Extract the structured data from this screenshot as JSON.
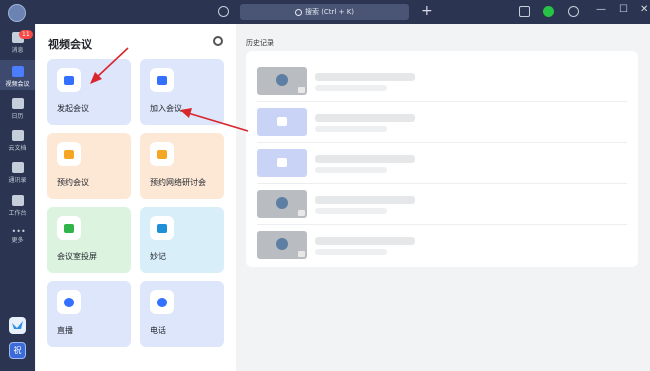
{
  "rail": {
    "badge": "11",
    "items": [
      {
        "label": "消息"
      },
      {
        "label": "视频会议"
      },
      {
        "label": "日历"
      },
      {
        "label": "云文档"
      },
      {
        "label": "通讯录"
      },
      {
        "label": "工作台"
      },
      {
        "label": "更多"
      }
    ],
    "bottom_user": "祝"
  },
  "topbar": {
    "search_placeholder": "搜索 (Ctrl + K)"
  },
  "panel": {
    "title": "视频会议",
    "cards": [
      {
        "label": "发起会议",
        "icon": "video-camera-icon"
      },
      {
        "label": "加入会议",
        "icon": "plus-icon"
      },
      {
        "label": "预约会议",
        "icon": "calendar-icon"
      },
      {
        "label": "预约网络研讨会",
        "icon": "podium-icon"
      },
      {
        "label": "会议室投屏",
        "icon": "screen-share-icon"
      },
      {
        "label": "妙记",
        "icon": "notes-icon"
      },
      {
        "label": "直播",
        "icon": "live-icon"
      },
      {
        "label": "电话",
        "icon": "phone-icon"
      }
    ]
  },
  "history": {
    "label": "历史记录"
  },
  "colors": {
    "rail": "#2b3450",
    "accent": "#3370ff",
    "arrow": "#d9262c"
  }
}
